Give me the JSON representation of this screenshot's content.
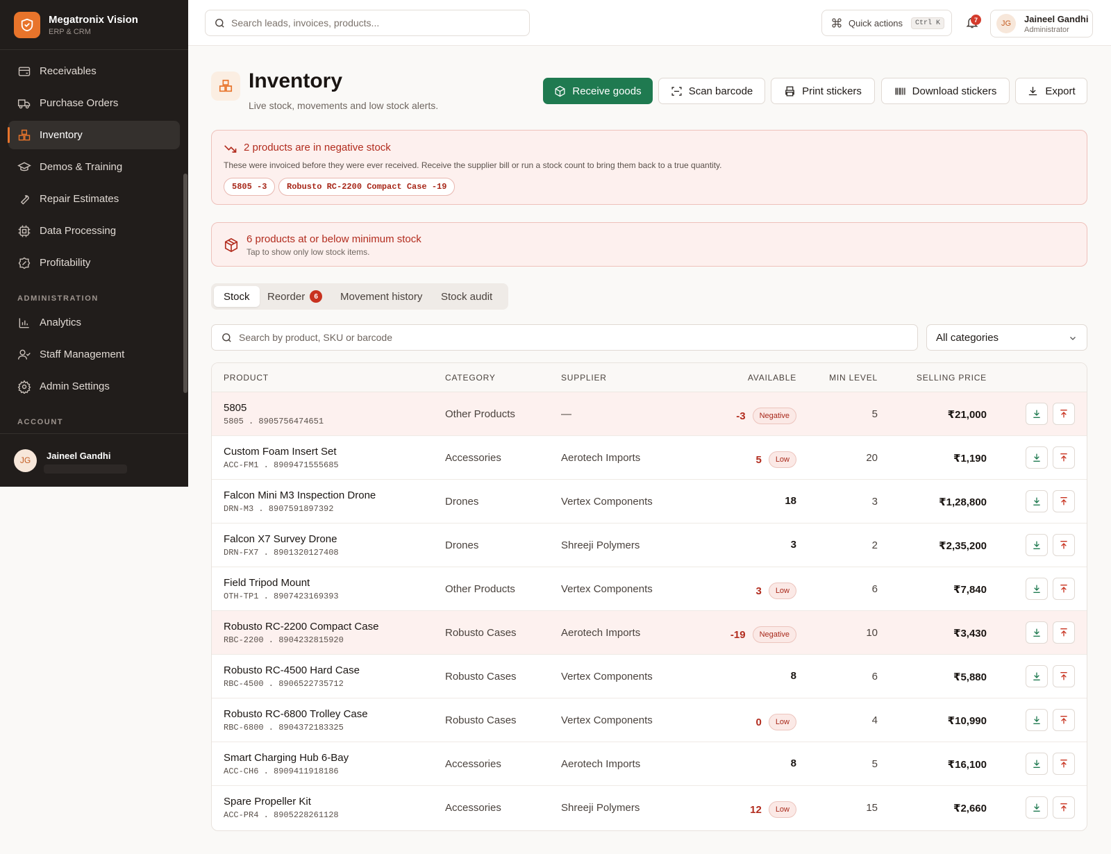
{
  "brand": {
    "name": "Megatronix Vision",
    "subtitle": "ERP & CRM"
  },
  "sidebar": {
    "items": [
      {
        "label": "Receivables",
        "icon": "receipt-icon"
      },
      {
        "label": "Purchase Orders",
        "icon": "truck-icon"
      },
      {
        "label": "Inventory",
        "icon": "boxes-icon",
        "active": true
      },
      {
        "label": "Demos & Training",
        "icon": "graduation-cap-icon"
      },
      {
        "label": "Repair Estimates",
        "icon": "wrench-icon"
      },
      {
        "label": "Data Processing",
        "icon": "cpu-icon"
      },
      {
        "label": "Profitability",
        "icon": "badge-percent-icon"
      }
    ],
    "admin_section": "ADMINISTRATION",
    "admin_items": [
      {
        "label": "Analytics",
        "icon": "bar-chart-icon"
      },
      {
        "label": "Staff Management",
        "icon": "users-icon"
      },
      {
        "label": "Admin Settings",
        "icon": "gear-icon"
      }
    ],
    "account_section": "ACCOUNT",
    "account": {
      "initials": "JG",
      "name": "Jaineel Gandhi"
    }
  },
  "topbar": {
    "search_placeholder": "Search leads, invoices, products...",
    "quick_actions": "Quick actions",
    "shortcut": "Ctrl K",
    "notification_count": "7",
    "user": {
      "initials": "JG",
      "name": "Jaineel Gandhi",
      "role": "Administrator"
    }
  },
  "page": {
    "title": "Inventory",
    "subtitle": "Live stock, movements and low stock alerts.",
    "actions": {
      "receive": "Receive goods",
      "scan": "Scan barcode",
      "print": "Print stickers",
      "download": "Download stickers",
      "export": "Export"
    }
  },
  "negative_alert": {
    "title": "2 products are in negative stock",
    "description": "These were invoiced before they were ever received. Receive the supplier bill or run a stock count to bring them back to a true quantity.",
    "chips": [
      "5805 -3",
      "Robusto RC-2200 Compact Case -19"
    ]
  },
  "low_alert": {
    "title": "6 products at or below minimum stock",
    "subtitle": "Tap to show only low stock items."
  },
  "tabs": {
    "stock": "Stock",
    "reorder": "Reorder",
    "reorder_count": "6",
    "movement": "Movement history",
    "audit": "Stock audit"
  },
  "filters": {
    "search_placeholder": "Search by product, SKU or barcode",
    "category": "All categories"
  },
  "table": {
    "headers": {
      "product": "PRODUCT",
      "category": "CATEGORY",
      "supplier": "SUPPLIER",
      "available": "AVAILABLE",
      "min_level": "MIN LEVEL",
      "selling_price": "SELLING PRICE"
    },
    "rows": [
      {
        "name": "5805",
        "sku": "5805 . 8905756474651",
        "category": "Other Products",
        "supplier": "—",
        "available": "-3",
        "status": "Negative",
        "min": "5",
        "price": "₹21,000"
      },
      {
        "name": "Custom Foam Insert Set",
        "sku": "ACC-FM1 . 8909471555685",
        "category": "Accessories",
        "supplier": "Aerotech Imports",
        "available": "5",
        "status": "Low",
        "min": "20",
        "price": "₹1,190"
      },
      {
        "name": "Falcon Mini M3 Inspection Drone",
        "sku": "DRN-M3 . 8907591897392",
        "category": "Drones",
        "supplier": "Vertex Components",
        "available": "18",
        "status": "",
        "min": "3",
        "price": "₹1,28,800"
      },
      {
        "name": "Falcon X7 Survey Drone",
        "sku": "DRN-FX7 . 8901320127408",
        "category": "Drones",
        "supplier": "Shreeji Polymers",
        "available": "3",
        "status": "",
        "min": "2",
        "price": "₹2,35,200"
      },
      {
        "name": "Field Tripod Mount",
        "sku": "OTH-TP1 . 8907423169393",
        "category": "Other Products",
        "supplier": "Vertex Components",
        "available": "3",
        "status": "Low",
        "min": "6",
        "price": "₹7,840"
      },
      {
        "name": "Robusto RC-2200 Compact Case",
        "sku": "RBC-2200 . 8904232815920",
        "category": "Robusto Cases",
        "supplier": "Aerotech Imports",
        "available": "-19",
        "status": "Negative",
        "min": "10",
        "price": "₹3,430"
      },
      {
        "name": "Robusto RC-4500 Hard Case",
        "sku": "RBC-4500 . 8906522735712",
        "category": "Robusto Cases",
        "supplier": "Vertex Components",
        "available": "8",
        "status": "",
        "min": "6",
        "price": "₹5,880"
      },
      {
        "name": "Robusto RC-6800 Trolley Case",
        "sku": "RBC-6800 . 8904372183325",
        "category": "Robusto Cases",
        "supplier": "Vertex Components",
        "available": "0",
        "status": "Low",
        "min": "4",
        "price": "₹10,990"
      },
      {
        "name": "Smart Charging Hub 6-Bay",
        "sku": "ACC-CH6 . 8909411918186",
        "category": "Accessories",
        "supplier": "Aerotech Imports",
        "available": "8",
        "status": "",
        "min": "5",
        "price": "₹16,100"
      },
      {
        "name": "Spare Propeller Kit",
        "sku": "ACC-PR4 . 8905228261128",
        "category": "Accessories",
        "supplier": "Shreeji Polymers",
        "available": "12",
        "status": "Low",
        "min": "15",
        "price": "₹2,660"
      }
    ]
  },
  "colors": {
    "accent": "#e8742b",
    "primary": "#1f7a50",
    "danger": "#b22c1e",
    "sidebar": "#211d1b"
  }
}
